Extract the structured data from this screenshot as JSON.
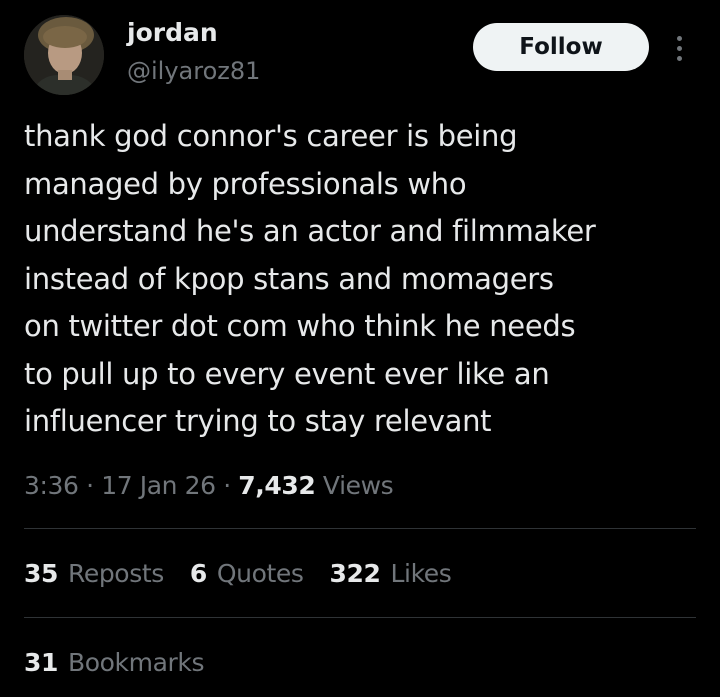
{
  "author": {
    "display_name": "jordan",
    "handle": "@ilyaroz81",
    "avatar_icon": "avatar"
  },
  "actions": {
    "follow_label": "Follow",
    "more_icon": "more-vertical-icon"
  },
  "post": {
    "text": "thank god connor's career is being\nmanaged by professionals who\nunderstand he's an actor and filmmaker\ninstead of kpop stans and momagers\non twitter dot com who think he needs\nto pull up to every event ever like an\ninfluencer trying to stay relevant"
  },
  "meta": {
    "time": "3:36",
    "separator": "·",
    "date": "17 Jan 26",
    "views_count": "7,432",
    "views_label": "Views"
  },
  "stats": {
    "reposts": {
      "count": "35",
      "label": "Reposts"
    },
    "quotes": {
      "count": "6",
      "label": "Quotes"
    },
    "likes": {
      "count": "322",
      "label": "Likes"
    },
    "bookmarks": {
      "count": "31",
      "label": "Bookmarks"
    }
  },
  "colors": {
    "background": "#000000",
    "text_primary": "#e7e9ea",
    "text_secondary": "#71767b",
    "divider": "#2f3336",
    "follow_bg": "#eff3f4"
  }
}
